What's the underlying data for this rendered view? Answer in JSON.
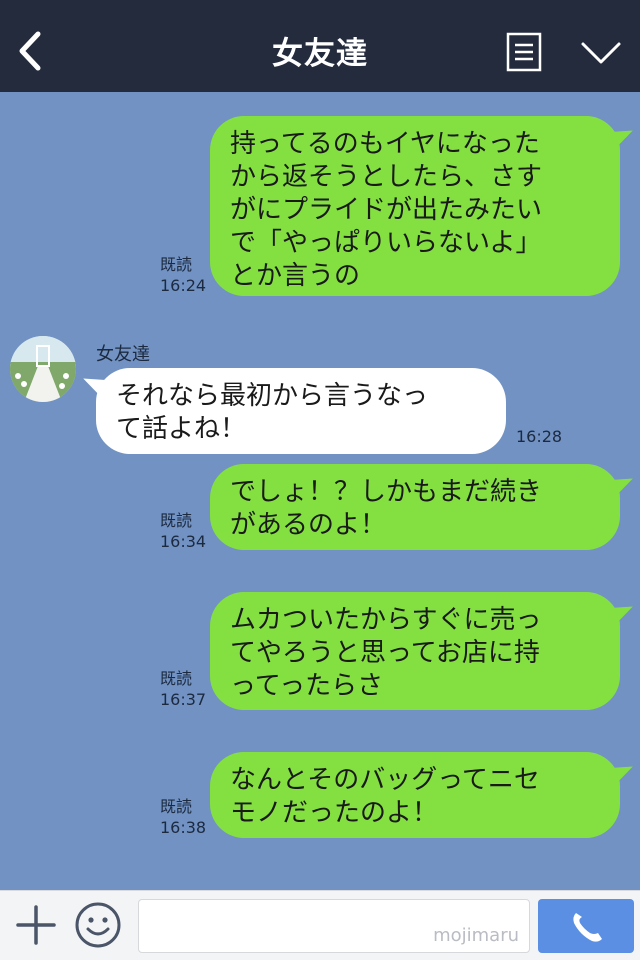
{
  "header": {
    "title": "女友達",
    "back_icon": "chevron-left-icon",
    "menu_icon": "note-list-icon",
    "expand_icon": "chevron-down-icon"
  },
  "contact": {
    "name": "女友達",
    "avatar_icon": "wedding-aisle-photo"
  },
  "messages": [
    {
      "direction": "out",
      "lines": [
        "持ってるのもイヤになった",
        "から返そうとしたら、さす",
        "がにプライドが出たみたい",
        "で「やっぱりいらないよ」",
        "とか言うの"
      ],
      "read": "既読",
      "time": "16:24"
    },
    {
      "direction": "in",
      "lines": [
        "それなら最初から言うなっ",
        "て話よね！"
      ],
      "time": "16:28"
    },
    {
      "direction": "out",
      "lines": [
        "でしょ！？しかもまだ続き",
        "があるのよ！"
      ],
      "read": "既読",
      "time": "16:34"
    },
    {
      "direction": "out",
      "lines": [
        "ムカついたからすぐに売っ",
        "てやろうと思ってお店に持",
        "ってったらさ"
      ],
      "read": "既読",
      "time": "16:37"
    },
    {
      "direction": "out",
      "lines": [
        "なんとそのバッグってニセ",
        "モノだったのよ！"
      ],
      "read": "既読",
      "time": "16:38"
    }
  ],
  "input": {
    "placeholder": "",
    "watermark": "mojimaru",
    "plus_icon": "plus-icon",
    "sticker_icon": "smiley-icon",
    "call_icon": "phone-icon"
  },
  "colors": {
    "header_bg": "#232b3d",
    "chat_bg": "#7192c2",
    "out_bubble": "#84e041",
    "in_bubble": "#ffffff",
    "call_button": "#5a8fe3"
  }
}
